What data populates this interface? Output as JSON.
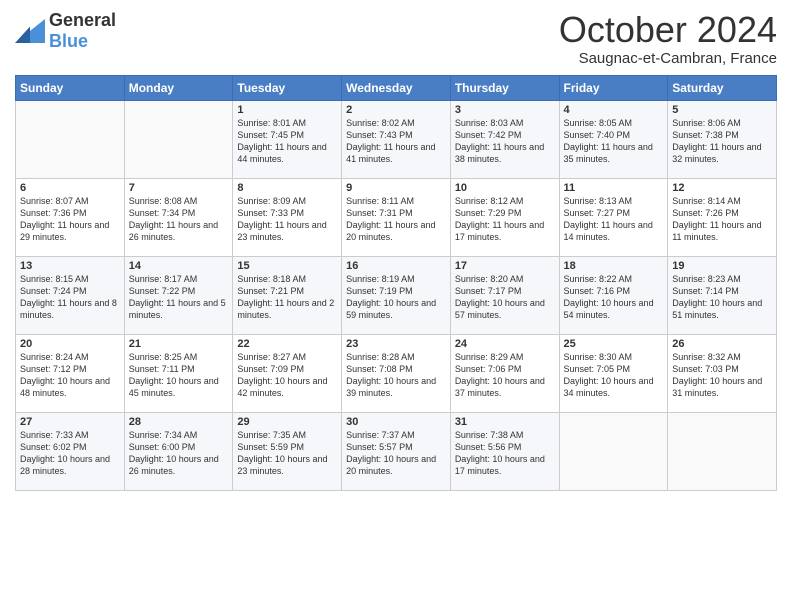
{
  "logo": {
    "general": "General",
    "blue": "Blue"
  },
  "header": {
    "title": "October 2024",
    "location": "Saugnac-et-Cambran, France"
  },
  "columns": [
    "Sunday",
    "Monday",
    "Tuesday",
    "Wednesday",
    "Thursday",
    "Friday",
    "Saturday"
  ],
  "weeks": [
    [
      {
        "day": "",
        "sunrise": "",
        "sunset": "",
        "daylight": ""
      },
      {
        "day": "",
        "sunrise": "",
        "sunset": "",
        "daylight": ""
      },
      {
        "day": "1",
        "sunrise": "Sunrise: 8:01 AM",
        "sunset": "Sunset: 7:45 PM",
        "daylight": "Daylight: 11 hours and 44 minutes."
      },
      {
        "day": "2",
        "sunrise": "Sunrise: 8:02 AM",
        "sunset": "Sunset: 7:43 PM",
        "daylight": "Daylight: 11 hours and 41 minutes."
      },
      {
        "day": "3",
        "sunrise": "Sunrise: 8:03 AM",
        "sunset": "Sunset: 7:42 PM",
        "daylight": "Daylight: 11 hours and 38 minutes."
      },
      {
        "day": "4",
        "sunrise": "Sunrise: 8:05 AM",
        "sunset": "Sunset: 7:40 PM",
        "daylight": "Daylight: 11 hours and 35 minutes."
      },
      {
        "day": "5",
        "sunrise": "Sunrise: 8:06 AM",
        "sunset": "Sunset: 7:38 PM",
        "daylight": "Daylight: 11 hours and 32 minutes."
      }
    ],
    [
      {
        "day": "6",
        "sunrise": "Sunrise: 8:07 AM",
        "sunset": "Sunset: 7:36 PM",
        "daylight": "Daylight: 11 hours and 29 minutes."
      },
      {
        "day": "7",
        "sunrise": "Sunrise: 8:08 AM",
        "sunset": "Sunset: 7:34 PM",
        "daylight": "Daylight: 11 hours and 26 minutes."
      },
      {
        "day": "8",
        "sunrise": "Sunrise: 8:09 AM",
        "sunset": "Sunset: 7:33 PM",
        "daylight": "Daylight: 11 hours and 23 minutes."
      },
      {
        "day": "9",
        "sunrise": "Sunrise: 8:11 AM",
        "sunset": "Sunset: 7:31 PM",
        "daylight": "Daylight: 11 hours and 20 minutes."
      },
      {
        "day": "10",
        "sunrise": "Sunrise: 8:12 AM",
        "sunset": "Sunset: 7:29 PM",
        "daylight": "Daylight: 11 hours and 17 minutes."
      },
      {
        "day": "11",
        "sunrise": "Sunrise: 8:13 AM",
        "sunset": "Sunset: 7:27 PM",
        "daylight": "Daylight: 11 hours and 14 minutes."
      },
      {
        "day": "12",
        "sunrise": "Sunrise: 8:14 AM",
        "sunset": "Sunset: 7:26 PM",
        "daylight": "Daylight: 11 hours and 11 minutes."
      }
    ],
    [
      {
        "day": "13",
        "sunrise": "Sunrise: 8:15 AM",
        "sunset": "Sunset: 7:24 PM",
        "daylight": "Daylight: 11 hours and 8 minutes."
      },
      {
        "day": "14",
        "sunrise": "Sunrise: 8:17 AM",
        "sunset": "Sunset: 7:22 PM",
        "daylight": "Daylight: 11 hours and 5 minutes."
      },
      {
        "day": "15",
        "sunrise": "Sunrise: 8:18 AM",
        "sunset": "Sunset: 7:21 PM",
        "daylight": "Daylight: 11 hours and 2 minutes."
      },
      {
        "day": "16",
        "sunrise": "Sunrise: 8:19 AM",
        "sunset": "Sunset: 7:19 PM",
        "daylight": "Daylight: 10 hours and 59 minutes."
      },
      {
        "day": "17",
        "sunrise": "Sunrise: 8:20 AM",
        "sunset": "Sunset: 7:17 PM",
        "daylight": "Daylight: 10 hours and 57 minutes."
      },
      {
        "day": "18",
        "sunrise": "Sunrise: 8:22 AM",
        "sunset": "Sunset: 7:16 PM",
        "daylight": "Daylight: 10 hours and 54 minutes."
      },
      {
        "day": "19",
        "sunrise": "Sunrise: 8:23 AM",
        "sunset": "Sunset: 7:14 PM",
        "daylight": "Daylight: 10 hours and 51 minutes."
      }
    ],
    [
      {
        "day": "20",
        "sunrise": "Sunrise: 8:24 AM",
        "sunset": "Sunset: 7:12 PM",
        "daylight": "Daylight: 10 hours and 48 minutes."
      },
      {
        "day": "21",
        "sunrise": "Sunrise: 8:25 AM",
        "sunset": "Sunset: 7:11 PM",
        "daylight": "Daylight: 10 hours and 45 minutes."
      },
      {
        "day": "22",
        "sunrise": "Sunrise: 8:27 AM",
        "sunset": "Sunset: 7:09 PM",
        "daylight": "Daylight: 10 hours and 42 minutes."
      },
      {
        "day": "23",
        "sunrise": "Sunrise: 8:28 AM",
        "sunset": "Sunset: 7:08 PM",
        "daylight": "Daylight: 10 hours and 39 minutes."
      },
      {
        "day": "24",
        "sunrise": "Sunrise: 8:29 AM",
        "sunset": "Sunset: 7:06 PM",
        "daylight": "Daylight: 10 hours and 37 minutes."
      },
      {
        "day": "25",
        "sunrise": "Sunrise: 8:30 AM",
        "sunset": "Sunset: 7:05 PM",
        "daylight": "Daylight: 10 hours and 34 minutes."
      },
      {
        "day": "26",
        "sunrise": "Sunrise: 8:32 AM",
        "sunset": "Sunset: 7:03 PM",
        "daylight": "Daylight: 10 hours and 31 minutes."
      }
    ],
    [
      {
        "day": "27",
        "sunrise": "Sunrise: 7:33 AM",
        "sunset": "Sunset: 6:02 PM",
        "daylight": "Daylight: 10 hours and 28 minutes."
      },
      {
        "day": "28",
        "sunrise": "Sunrise: 7:34 AM",
        "sunset": "Sunset: 6:00 PM",
        "daylight": "Daylight: 10 hours and 26 minutes."
      },
      {
        "day": "29",
        "sunrise": "Sunrise: 7:35 AM",
        "sunset": "Sunset: 5:59 PM",
        "daylight": "Daylight: 10 hours and 23 minutes."
      },
      {
        "day": "30",
        "sunrise": "Sunrise: 7:37 AM",
        "sunset": "Sunset: 5:57 PM",
        "daylight": "Daylight: 10 hours and 20 minutes."
      },
      {
        "day": "31",
        "sunrise": "Sunrise: 7:38 AM",
        "sunset": "Sunset: 5:56 PM",
        "daylight": "Daylight: 10 hours and 17 minutes."
      },
      {
        "day": "",
        "sunrise": "",
        "sunset": "",
        "daylight": ""
      },
      {
        "day": "",
        "sunrise": "",
        "sunset": "",
        "daylight": ""
      }
    ]
  ]
}
